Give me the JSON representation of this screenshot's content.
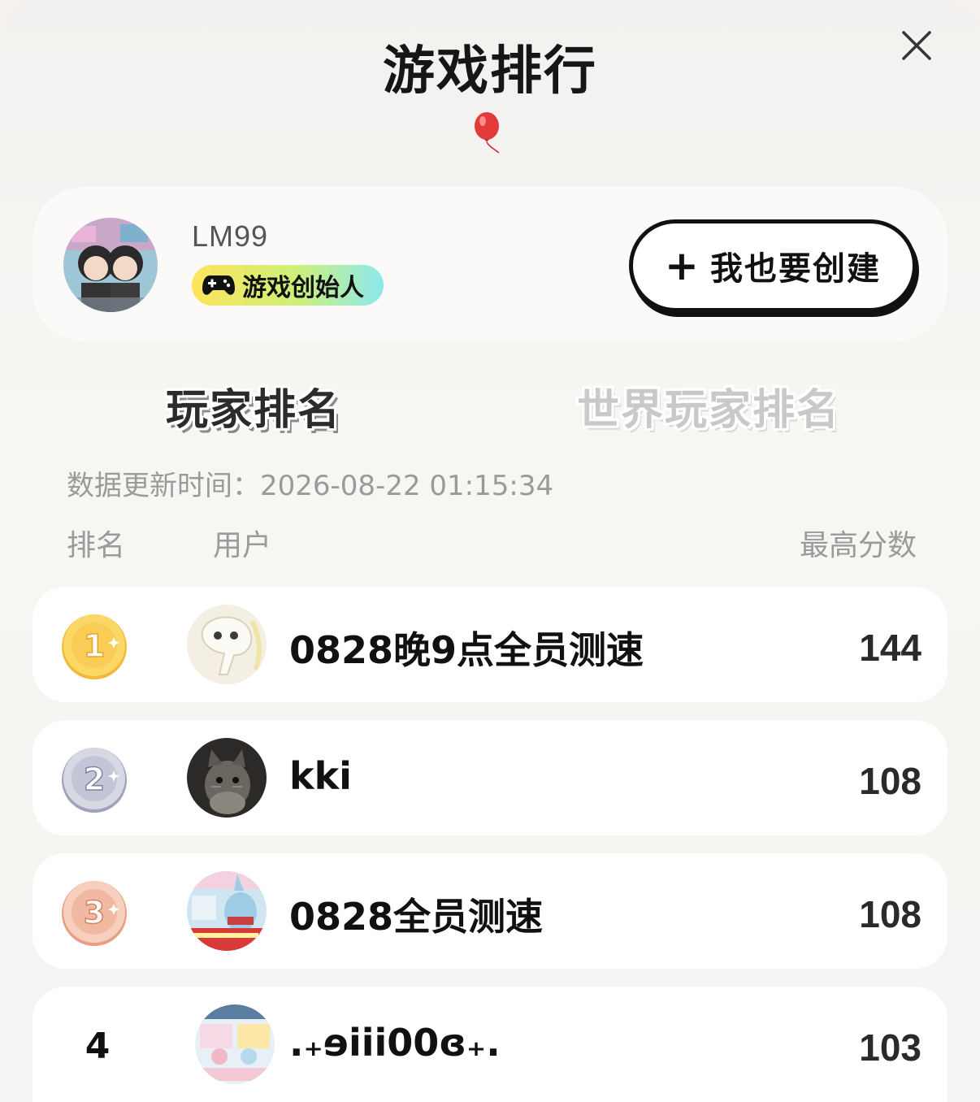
{
  "header": {
    "title": "游戏排行"
  },
  "profile": {
    "username": "LM99",
    "badge_label": "游戏创始人",
    "create_button_label": "我也要创建",
    "create_button_icon": "plus-icon"
  },
  "tabs": [
    {
      "label": "玩家排名",
      "active": true
    },
    {
      "label": "世界玩家排名",
      "active": false
    }
  ],
  "update_time_text": "数据更新时间：2026-08-22 01:15:34",
  "columns": {
    "rank": "排名",
    "user": "用户",
    "score": "最高分数"
  },
  "leaderboard": [
    {
      "rank": "1",
      "name": "0828晚9点全员测速",
      "score": "144",
      "medal": "gold"
    },
    {
      "rank": "2",
      "name": "kki",
      "score": "108",
      "medal": "silver"
    },
    {
      "rank": "3",
      "name": "0828全员测速",
      "score": "108",
      "medal": "bronze"
    },
    {
      "rank": "4",
      "name": ".₊ɘiii00ɞ₊.",
      "score": "103",
      "medal": ""
    }
  ],
  "colors": {
    "gold": "#f5c84a",
    "silver": "#b9bccb",
    "bronze": "#f0b8a0",
    "badge_gradient": [
      "#ffe45c",
      "#8ce9ee"
    ]
  }
}
